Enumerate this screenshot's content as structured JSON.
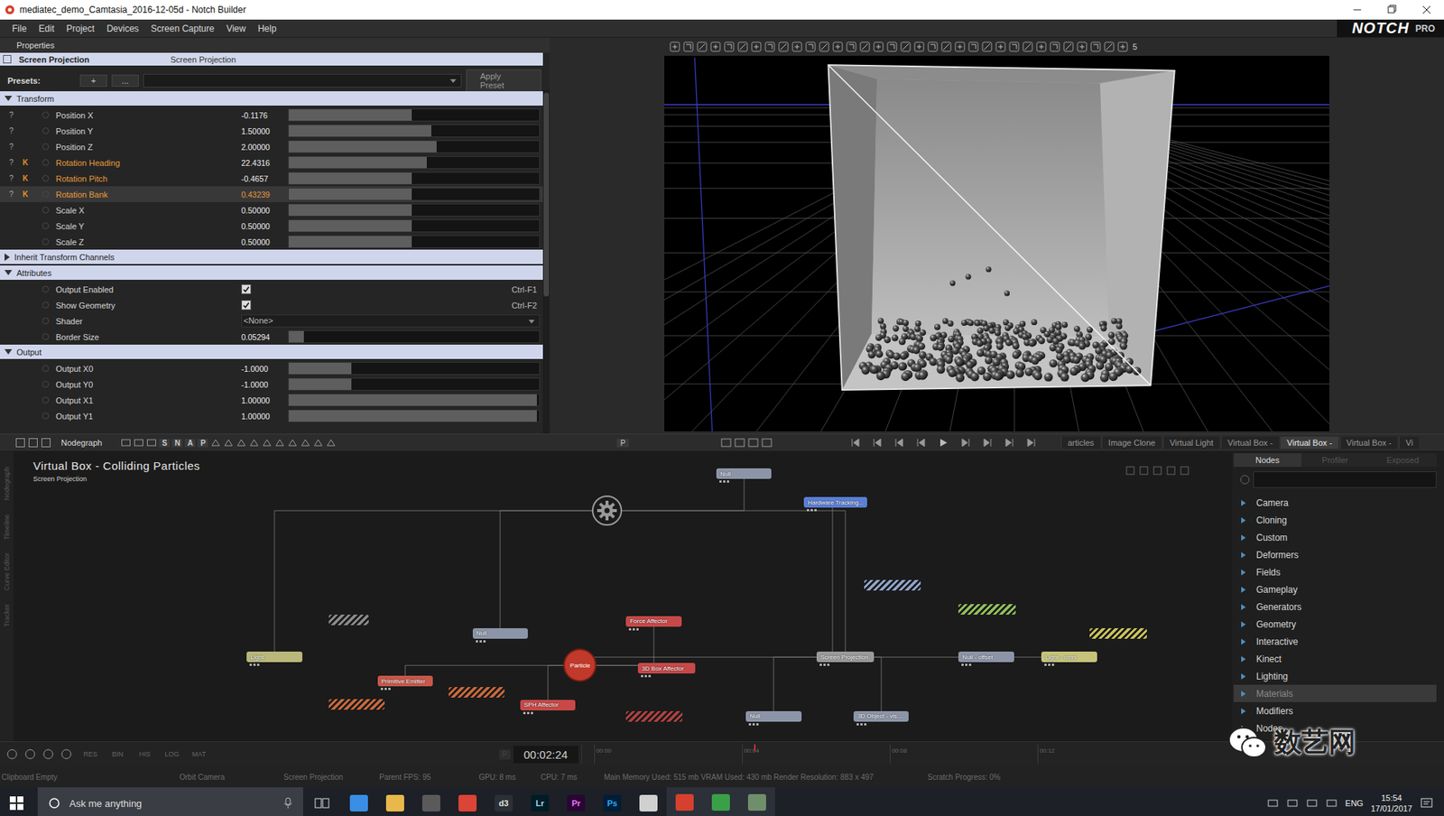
{
  "window": {
    "title": "mediatec_demo_Camtasia_2016-12-05d - Notch Builder"
  },
  "menu": [
    "File",
    "Edit",
    "Project",
    "Devices",
    "Screen Capture",
    "View",
    "Help"
  ],
  "logo": {
    "name": "NOTCH",
    "edition": "PRO"
  },
  "properties": {
    "panel_title": "Properties",
    "node_name": "Screen Projection",
    "node_type": "Screen Projection",
    "presets": {
      "label": "Presets:",
      "add": "+",
      "more": "...",
      "apply": "Apply Preset"
    },
    "sections": [
      {
        "title": "Transform",
        "expanded": true,
        "rows": [
          {
            "name": "Position X",
            "kind": "slider",
            "value": "-0.1176",
            "level": 0.49,
            "mark": "?",
            "key": "",
            "keyed": false,
            "selected": false
          },
          {
            "name": "Position Y",
            "kind": "slider",
            "value": "1.50000",
            "level": 0.57,
            "mark": "?",
            "key": "",
            "keyed": false,
            "selected": false
          },
          {
            "name": "Position Z",
            "kind": "slider",
            "value": "2.00000",
            "level": 0.59,
            "mark": "?",
            "key": "",
            "keyed": false,
            "selected": false
          },
          {
            "name": "Rotation Heading",
            "kind": "slider",
            "value": "22.4316",
            "level": 0.55,
            "mark": "?",
            "key": "K",
            "keyed": true,
            "selected": false
          },
          {
            "name": "Rotation Pitch",
            "kind": "slider",
            "value": "-0.4657",
            "level": 0.49,
            "mark": "?",
            "key": "K",
            "keyed": true,
            "selected": false
          },
          {
            "name": "Rotation Bank",
            "kind": "slider",
            "value": "0.43239",
            "level": 0.49,
            "mark": "?",
            "key": "K",
            "keyed": true,
            "selected": true
          },
          {
            "name": "Scale X",
            "kind": "slider",
            "value": "0.50000",
            "level": 0.49,
            "mark": "",
            "key": "",
            "keyed": false,
            "selected": false
          },
          {
            "name": "Scale Y",
            "kind": "slider",
            "value": "0.50000",
            "level": 0.49,
            "mark": "",
            "key": "",
            "keyed": false,
            "selected": false
          },
          {
            "name": "Scale Z",
            "kind": "slider",
            "value": "0.50000",
            "level": 0.49,
            "mark": "",
            "key": "",
            "keyed": false,
            "selected": false
          }
        ]
      },
      {
        "title": "Inherit Transform Channels",
        "expanded": false,
        "rows": []
      },
      {
        "title": "Attributes",
        "expanded": true,
        "rows": [
          {
            "name": "Output Enabled",
            "kind": "checkbox",
            "checked": true,
            "shortcut": "Ctrl-F1",
            "mark": "",
            "key": "",
            "keyed": false,
            "selected": false
          },
          {
            "name": "Show Geometry",
            "kind": "checkbox",
            "checked": true,
            "shortcut": "Ctrl-F2",
            "mark": "",
            "key": "",
            "keyed": false,
            "selected": false
          },
          {
            "name": "Shader",
            "kind": "dropdown",
            "value": "<None>",
            "mark": "",
            "key": "",
            "keyed": false,
            "selected": false
          },
          {
            "name": "Border Size",
            "kind": "slider",
            "value": "0.05294",
            "level": 0.06,
            "mark": "",
            "key": "",
            "keyed": false,
            "selected": false
          }
        ]
      },
      {
        "title": "Output",
        "expanded": true,
        "rows": [
          {
            "name": "Output X0",
            "kind": "slider",
            "value": "-1.0000",
            "level": 0.25,
            "mark": "",
            "key": "",
            "keyed": false,
            "selected": false
          },
          {
            "name": "Output Y0",
            "kind": "slider",
            "value": "-1.0000",
            "level": 0.25,
            "mark": "",
            "key": "",
            "keyed": false,
            "selected": false
          },
          {
            "name": "Output X1",
            "kind": "slider",
            "value": "1.00000",
            "level": 0.99,
            "mark": "",
            "key": "",
            "keyed": false,
            "selected": false
          },
          {
            "name": "Output Y1",
            "kind": "slider",
            "value": "1.00000",
            "level": 0.99,
            "mark": "",
            "key": "",
            "keyed": false,
            "selected": false
          }
        ]
      }
    ]
  },
  "viewport_toolbar": {
    "counter": "5"
  },
  "nodegraph": {
    "toolbar_label": "Nodegraph",
    "toggles": [
      "S",
      "N",
      "A",
      "P"
    ],
    "pin": "P",
    "title": "Virtual Box - Colliding Particles",
    "subtitle": "Screen Projection",
    "side_tabs": [
      "Nodegraph",
      "Timeline",
      "Curve Editor",
      "Tracker"
    ],
    "nodes": [
      {
        "kind": "node",
        "label": "Null",
        "color": "#8c95a8"
      },
      {
        "kind": "node",
        "label": "Hardware Tracking...",
        "color": "#5b7fd6"
      },
      {
        "kind": "hub",
        "label": "",
        "color": "#9a9a9a"
      },
      {
        "kind": "hatched",
        "label": "",
        "color": "#8ea3c8"
      },
      {
        "kind": "hatched",
        "label": "",
        "color": "#8fbf5a"
      },
      {
        "kind": "hatched",
        "label": "",
        "color": "#c9c25a"
      },
      {
        "kind": "hatched",
        "label": "",
        "color": "#8a8a8a"
      },
      {
        "kind": "node",
        "label": "Null",
        "color": "#8c95a8"
      },
      {
        "kind": "node",
        "label": "Force Affector",
        "color": "#c84848"
      },
      {
        "kind": "node",
        "label": "Light",
        "color": "#b9b77a"
      },
      {
        "kind": "particle",
        "label": "Particle",
        "color": "#c0392b"
      },
      {
        "kind": "node",
        "label": "3D Box Affector",
        "color": "#c84848"
      },
      {
        "kind": "node",
        "label": "Screen Projection",
        "color": "#9a9a9a"
      },
      {
        "kind": "node",
        "label": "Null - offset",
        "color": "#8c95a8"
      },
      {
        "kind": "node",
        "label": "Light - omni",
        "color": "#c6c47a"
      },
      {
        "kind": "node",
        "label": "Primitive Emitter",
        "color": "#c8584a"
      },
      {
        "kind": "hatched",
        "label": "",
        "color": "#c8683a"
      },
      {
        "kind": "hatched",
        "label": "",
        "color": "#c8683a"
      },
      {
        "kind": "node",
        "label": "SPH Affector",
        "color": "#c84848"
      },
      {
        "kind": "hatched",
        "label": "",
        "color": "#b04040"
      },
      {
        "kind": "node",
        "label": "Null",
        "color": "#8c95a8"
      },
      {
        "kind": "node",
        "label": "3D Object - vis...",
        "color": "#8c95a8"
      }
    ],
    "edges": [
      [
        9,
        2
      ],
      [
        7,
        2
      ],
      [
        12,
        2
      ],
      [
        0,
        2
      ],
      [
        1,
        12
      ],
      [
        10,
        12
      ],
      [
        8,
        10
      ],
      [
        11,
        10
      ],
      [
        15,
        10
      ],
      [
        18,
        10
      ],
      [
        13,
        12
      ],
      [
        14,
        13
      ],
      [
        20,
        12
      ],
      [
        21,
        12
      ]
    ]
  },
  "doc_tabs": [
    {
      "label": "articles",
      "selected": false
    },
    {
      "label": "Image Clone",
      "selected": false
    },
    {
      "label": "Virtual Light",
      "selected": false
    },
    {
      "label": "Virtual Box -",
      "selected": false
    },
    {
      "label": "Virtual Box -",
      "selected": true
    },
    {
      "label": "Virtual Box -",
      "selected": false
    },
    {
      "label": "Vi",
      "selected": false
    }
  ],
  "node_library": {
    "tabs": [
      {
        "label": "Nodes",
        "selected": true
      },
      {
        "label": "Profiler",
        "selected": false
      },
      {
        "label": "Exposed",
        "selected": false
      }
    ],
    "categories": [
      {
        "label": "Camera",
        "selected": false
      },
      {
        "label": "Cloning",
        "selected": false
      },
      {
        "label": "Custom",
        "selected": false
      },
      {
        "label": "Deformers",
        "selected": false
      },
      {
        "label": "Fields",
        "selected": false
      },
      {
        "label": "Gameplay",
        "selected": false
      },
      {
        "label": "Generators",
        "selected": false
      },
      {
        "label": "Geometry",
        "selected": false
      },
      {
        "label": "Interactive",
        "selected": false
      },
      {
        "label": "Kinect",
        "selected": false
      },
      {
        "label": "Lighting",
        "selected": false
      },
      {
        "label": "Materials",
        "selected": true
      },
      {
        "label": "Modifiers",
        "selected": false
      },
      {
        "label": "Nodes",
        "selected": false
      }
    ]
  },
  "timeline": {
    "buttons": [
      "RES",
      "BIN",
      "HIS",
      "LOG",
      "MAT"
    ],
    "pin": "P",
    "time": "00:02:24",
    "ticks": [
      "00:00",
      "00:04",
      "00:08",
      "00:12"
    ],
    "playhead": 0.2
  },
  "status": [
    "Clipboard Empty",
    "Orbit Camera",
    "Screen Projection",
    "Parent FPS: 95",
    "GPU: 8 ms",
    "CPU: 7 ms",
    "Main Memory Used: 515 mb VRAM Used: 430 mb Render Resolution: 883 x 497",
    "Scratch Progress: 0%"
  ],
  "taskbar": {
    "search": "Ask me anything",
    "apps": [
      {
        "label": "",
        "color": "#3a8ee6",
        "fg": "#ffffff",
        "active": false
      },
      {
        "label": "",
        "color": "#e8b84a",
        "fg": "#ffffff",
        "active": false
      },
      {
        "label": "",
        "color": "#5a5a5a",
        "fg": "#ffffff",
        "active": false
      },
      {
        "label": "",
        "color": "#db4437",
        "fg": "#ffffff",
        "active": false
      },
      {
        "label": "d3",
        "color": "#2b2f36",
        "fg": "#e0e0e0",
        "active": false
      },
      {
        "label": "Lr",
        "color": "#001d26",
        "fg": "#add5ec",
        "active": false
      },
      {
        "label": "Pr",
        "color": "#2a0634",
        "fg": "#ea77ff",
        "active": false
      },
      {
        "label": "Ps",
        "color": "#001e36",
        "fg": "#31a8ff",
        "active": false
      },
      {
        "label": "",
        "color": "#d0d0d0",
        "fg": "#ffffff",
        "active": false
      },
      {
        "label": "",
        "color": "#d6402e",
        "fg": "#ffffff",
        "active": true
      },
      {
        "label": "",
        "color": "#3aa048",
        "fg": "#ffffff",
        "active": true
      },
      {
        "label": "",
        "color": "#6f8f6a",
        "fg": "#ffffff",
        "active": true
      }
    ],
    "language": "ENG",
    "time": "15:54",
    "date": "17/01/2017"
  },
  "watermark": {
    "text": "数艺网"
  }
}
